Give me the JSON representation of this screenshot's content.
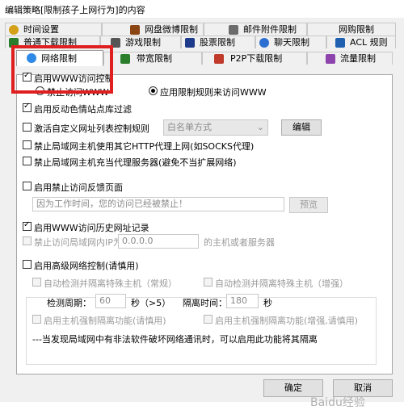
{
  "window": {
    "title": "编辑策略[限制孩子上网行为]的内容"
  },
  "tabs_row1": [
    {
      "label": "时间设置",
      "icon": "clock-icon",
      "color": "#b8860b"
    },
    {
      "label": "网盘微博限制",
      "icon": "cloud-icon",
      "color": "#8b4513"
    },
    {
      "label": "邮件附件限制",
      "icon": "mail-icon",
      "color": "#555555"
    },
    {
      "label": "网购限制",
      "icon": "cart-icon",
      "color": "#8a8a8a"
    }
  ],
  "tabs_row2": [
    {
      "label": "普通下载限制",
      "icon": "download-icon",
      "color": "#2a7d2a"
    },
    {
      "label": "游戏限制",
      "icon": "game-icon",
      "color": "#444444"
    },
    {
      "label": "股票限制",
      "icon": "stock-icon",
      "color": "#1e3a8a"
    },
    {
      "label": "聊天限制",
      "icon": "chat-icon",
      "color": "#2d6fd0"
    },
    {
      "label": "ACL 规则",
      "icon": "acl-icon",
      "color": "#2060b0"
    }
  ],
  "tabs_row3": [
    {
      "label": "网络限制",
      "icon": "globe-icon",
      "color": "#2e8ae6",
      "active": true
    },
    {
      "label": "带宽限制",
      "icon": "bandwidth-icon",
      "color": "#2a7d2a"
    },
    {
      "label": "P2P下载限制",
      "icon": "p2p-icon",
      "color": "#c0392b"
    },
    {
      "label": "流量限制",
      "icon": "traffic-icon",
      "color": "#8e44ad"
    }
  ],
  "www": {
    "enable_label": "启用WWW访问控制",
    "radio_block": "禁止访问WWW",
    "radio_rules": "应用限制规则来访问WWW"
  },
  "options": {
    "anti_proxy": "启用反动色情站点库过滤",
    "custom_url": "激活自定义网址列表控制规则",
    "whitelist_mode": "白名单方式",
    "edit_btn": "编辑",
    "block_http_proxy": "禁止局域网主机使用其它HTTP代理上网(如SOCKS代理)",
    "block_lan_proxy": "禁止局域网主机充当代理服务器(避免不当扩展网络)"
  },
  "feedback": {
    "label": "启用禁止访问反馈页面",
    "message": "因为工作时间，您的访问已经被禁止！",
    "preview_btn": "预览"
  },
  "history": {
    "label": "启用WWW访问历史网址记录",
    "block_ip_label": "禁止访问局域网内IP为",
    "ip_value": "0.0.0.0",
    "ip_suffix": "的主机或者服务器"
  },
  "advanced": {
    "label": "启用高级网络控制(请慎用)",
    "auto_detect_normal": "自动检测并隔离特殊主机（常规）",
    "auto_detect_enhanced": "自动检测并隔离特殊主机（增强）",
    "detect_period_label": "检测周期：",
    "detect_period_value": "60",
    "detect_period_unit": "秒（>5）",
    "isolate_time_label": "隔离时间：",
    "isolate_time_value": "180",
    "isolate_time_unit": "秒",
    "force_isolate": "启用主机强制隔离功能(请慎用)",
    "force_isolate_enhanced": "启用主机强制隔离功能(增强,请慎用)",
    "note": "---当发现局域网中有非法软件破坏网络通讯时，可以启用此功能将其隔离"
  },
  "footer": {
    "ok": "确定",
    "cancel": "取消"
  },
  "watermark": "Baidu经验"
}
